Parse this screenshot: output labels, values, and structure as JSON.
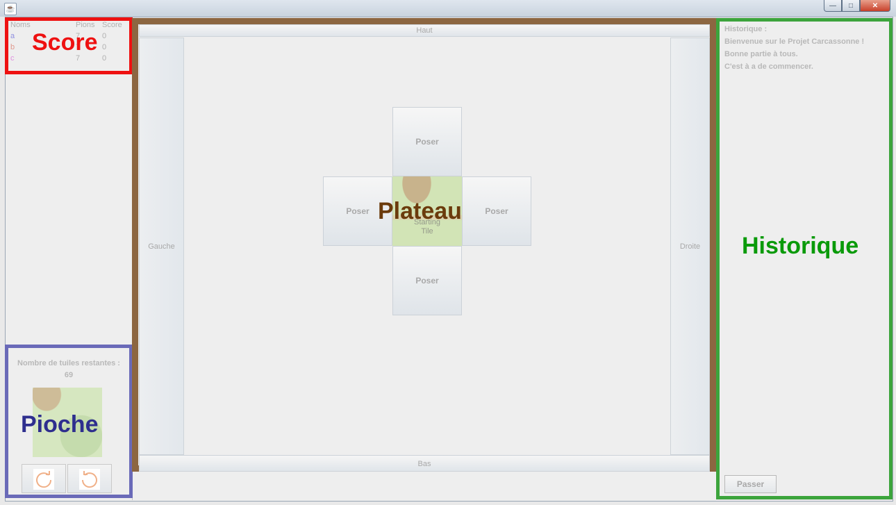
{
  "window": {
    "app_icon": "java-icon",
    "minimize_label": "—",
    "maximize_label": "□",
    "close_label": "✕"
  },
  "score": {
    "label": "Score",
    "headers": {
      "name": "Noms",
      "pions": "Pions",
      "score": "Score"
    },
    "rows": [
      {
        "name": "a",
        "pions": "7",
        "score": "0",
        "color": "#8f8fe0"
      },
      {
        "name": "b",
        "pions": "7",
        "score": "0",
        "color": "#e09a8f"
      },
      {
        "name": "c",
        "pions": "7",
        "score": "0",
        "color": "#e08fe0"
      }
    ]
  },
  "pioche": {
    "label": "Pioche",
    "title": "Nombre de tuiles restantes :",
    "count": "69",
    "rotate_right_icon": "rotate-clockwise-icon",
    "rotate_left_icon": "rotate-counterclockwise-icon"
  },
  "plateau": {
    "label": "Plateau",
    "haut": "Haut",
    "bas": "Bas",
    "gauche": "Gauche",
    "droite": "Droite",
    "poser": "Poser",
    "starting_tile": "Starting\nTile"
  },
  "historique": {
    "label": "Historique",
    "lines": [
      "Historique :",
      "Bienvenue sur le Projet Carcassonne !",
      "Bonne partie à tous.",
      "C'est à a de commencer."
    ],
    "passer": "Passer"
  }
}
